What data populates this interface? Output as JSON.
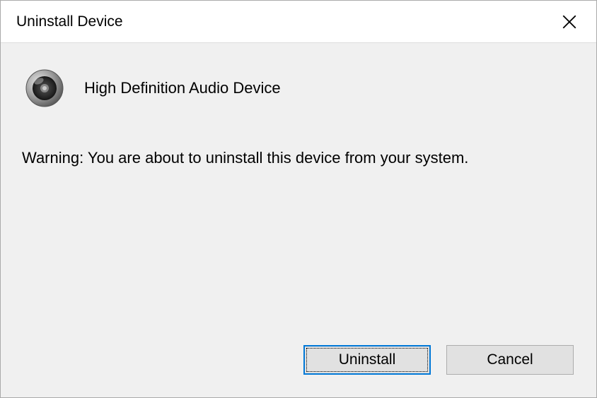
{
  "titlebar": {
    "title": "Uninstall Device"
  },
  "device": {
    "icon": "speaker-icon",
    "name": "High Definition Audio Device"
  },
  "warning": "Warning: You are about to uninstall this device from your system.",
  "buttons": {
    "uninstall": "Uninstall",
    "cancel": "Cancel"
  }
}
